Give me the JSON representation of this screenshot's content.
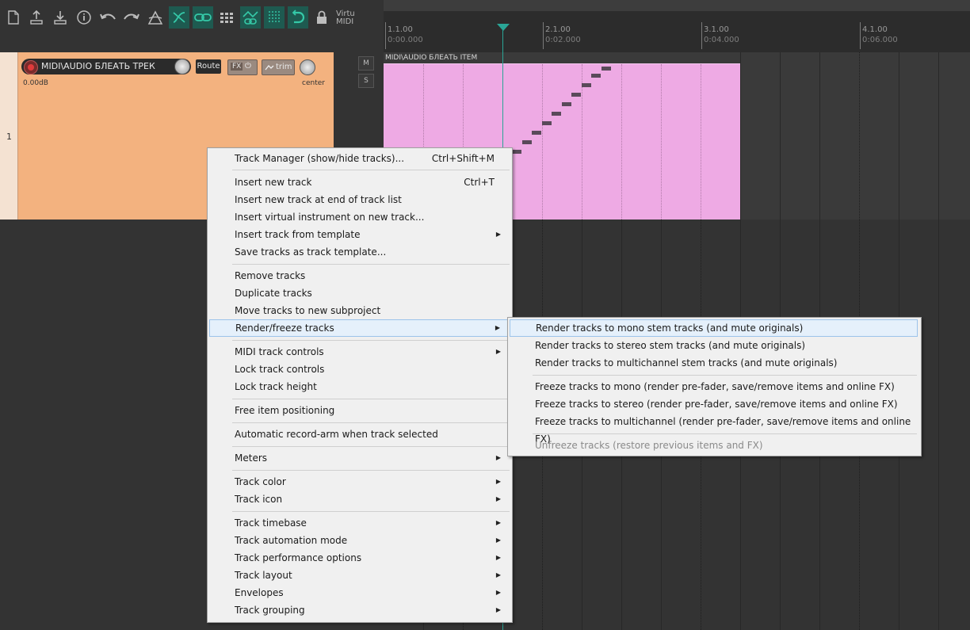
{
  "toolbar": {
    "virtual_midi_line1": "Virtu",
    "virtual_midi_line2": "MIDI"
  },
  "ruler": {
    "marks": [
      {
        "bar": "1.1.00",
        "time": "0:00.000"
      },
      {
        "bar": "2.1.00",
        "time": "0:02.000"
      },
      {
        "bar": "3.1.00",
        "time": "0:04.000"
      },
      {
        "bar": "4.1.00",
        "time": "0:06.000"
      }
    ]
  },
  "track": {
    "number": "1",
    "name": "MIDI\\AUDIO БЛЕАТЬ ТРЕК",
    "route_label": "Route",
    "fx_label": "FX",
    "fx_power": "⏻",
    "trim_label": "trim",
    "volume": "0.00dB",
    "pan": "center",
    "mute_label": "M",
    "solo_label": "S"
  },
  "item": {
    "name": "MIDI\\AUDIO БЛЕАТЬ ITEM"
  },
  "context_menu": {
    "items": [
      {
        "label": "Track Manager (show/hide tracks)...",
        "shortcut": "Ctrl+Shift+M"
      },
      {
        "label": "Insert new track",
        "shortcut": "Ctrl+T"
      },
      {
        "label": "Insert new track at end of track list"
      },
      {
        "label": "Insert virtual instrument on new track..."
      },
      {
        "label": "Insert track from template",
        "submenu": true
      },
      {
        "label": "Save tracks as track template..."
      },
      {
        "label": "Remove tracks"
      },
      {
        "label": "Duplicate tracks"
      },
      {
        "label": "Move tracks to new subproject"
      },
      {
        "label": "Render/freeze tracks",
        "submenu": true,
        "highlighted": true
      },
      {
        "label": "MIDI track controls",
        "submenu": true
      },
      {
        "label": "Lock track controls"
      },
      {
        "label": "Lock track height"
      },
      {
        "label": "Free item positioning"
      },
      {
        "label": "Automatic record-arm when track selected"
      },
      {
        "label": "Meters",
        "submenu": true
      },
      {
        "label": "Track color",
        "submenu": true
      },
      {
        "label": "Track icon",
        "submenu": true
      },
      {
        "label": "Track timebase",
        "submenu": true
      },
      {
        "label": "Track automation mode",
        "submenu": true
      },
      {
        "label": "Track performance options",
        "submenu": true
      },
      {
        "label": "Track layout",
        "submenu": true
      },
      {
        "label": "Envelopes",
        "submenu": true
      },
      {
        "label": "Track grouping",
        "submenu": true
      }
    ]
  },
  "render_submenu": {
    "items": [
      {
        "label": "Render tracks to mono stem tracks (and mute originals)",
        "highlighted": true
      },
      {
        "label": "Render tracks to stereo stem tracks (and mute originals)"
      },
      {
        "label": "Render tracks to multichannel stem tracks (and mute originals)"
      },
      {
        "label": "Freeze tracks to mono (render pre-fader, save/remove items and online FX)"
      },
      {
        "label": "Freeze tracks to stereo (render pre-fader, save/remove items and online FX)"
      },
      {
        "label": "Freeze tracks to multichannel (render pre-fader, save/remove items and online FX)"
      },
      {
        "label": "Unfreeze tracks (restore previous items and FX)",
        "disabled": true
      }
    ]
  },
  "colors": {
    "track_color": "#f3b27f",
    "item_color": "#eeaae4",
    "playhead_color": "#2aa596",
    "toolbar_active": "#1e5a50"
  },
  "icons": [
    "new-project-icon",
    "save-project-icon",
    "open-project-icon",
    "project-info-icon",
    "undo-icon",
    "redo-icon",
    "metronome-icon",
    "ripple-edit-icon",
    "link-icon",
    "grid-icon",
    "envelope-link-icon",
    "snap-grid-icon",
    "loop-icon",
    "lock-icon"
  ]
}
